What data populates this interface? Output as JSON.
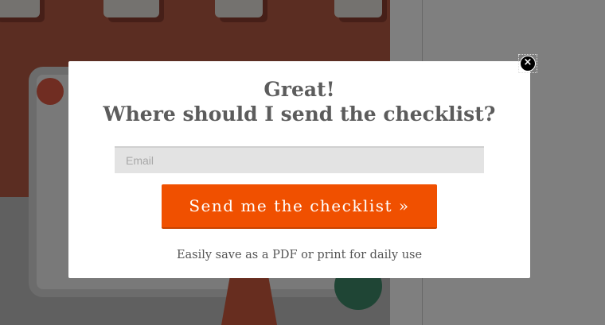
{
  "modal": {
    "title_line1": "Great!",
    "title_line2": "Where should I send the checklist?",
    "email_placeholder": "Email",
    "email_value": "",
    "submit_label": "Send me the checklist  »",
    "note": "Easily save as a PDF or print for daily use",
    "close_glyph": "×"
  },
  "colors": {
    "button": "#f05000",
    "title": "#5c5c5c",
    "overlay": "rgba(0,0,0,0.5)"
  },
  "icons": {
    "close": "close-icon"
  }
}
